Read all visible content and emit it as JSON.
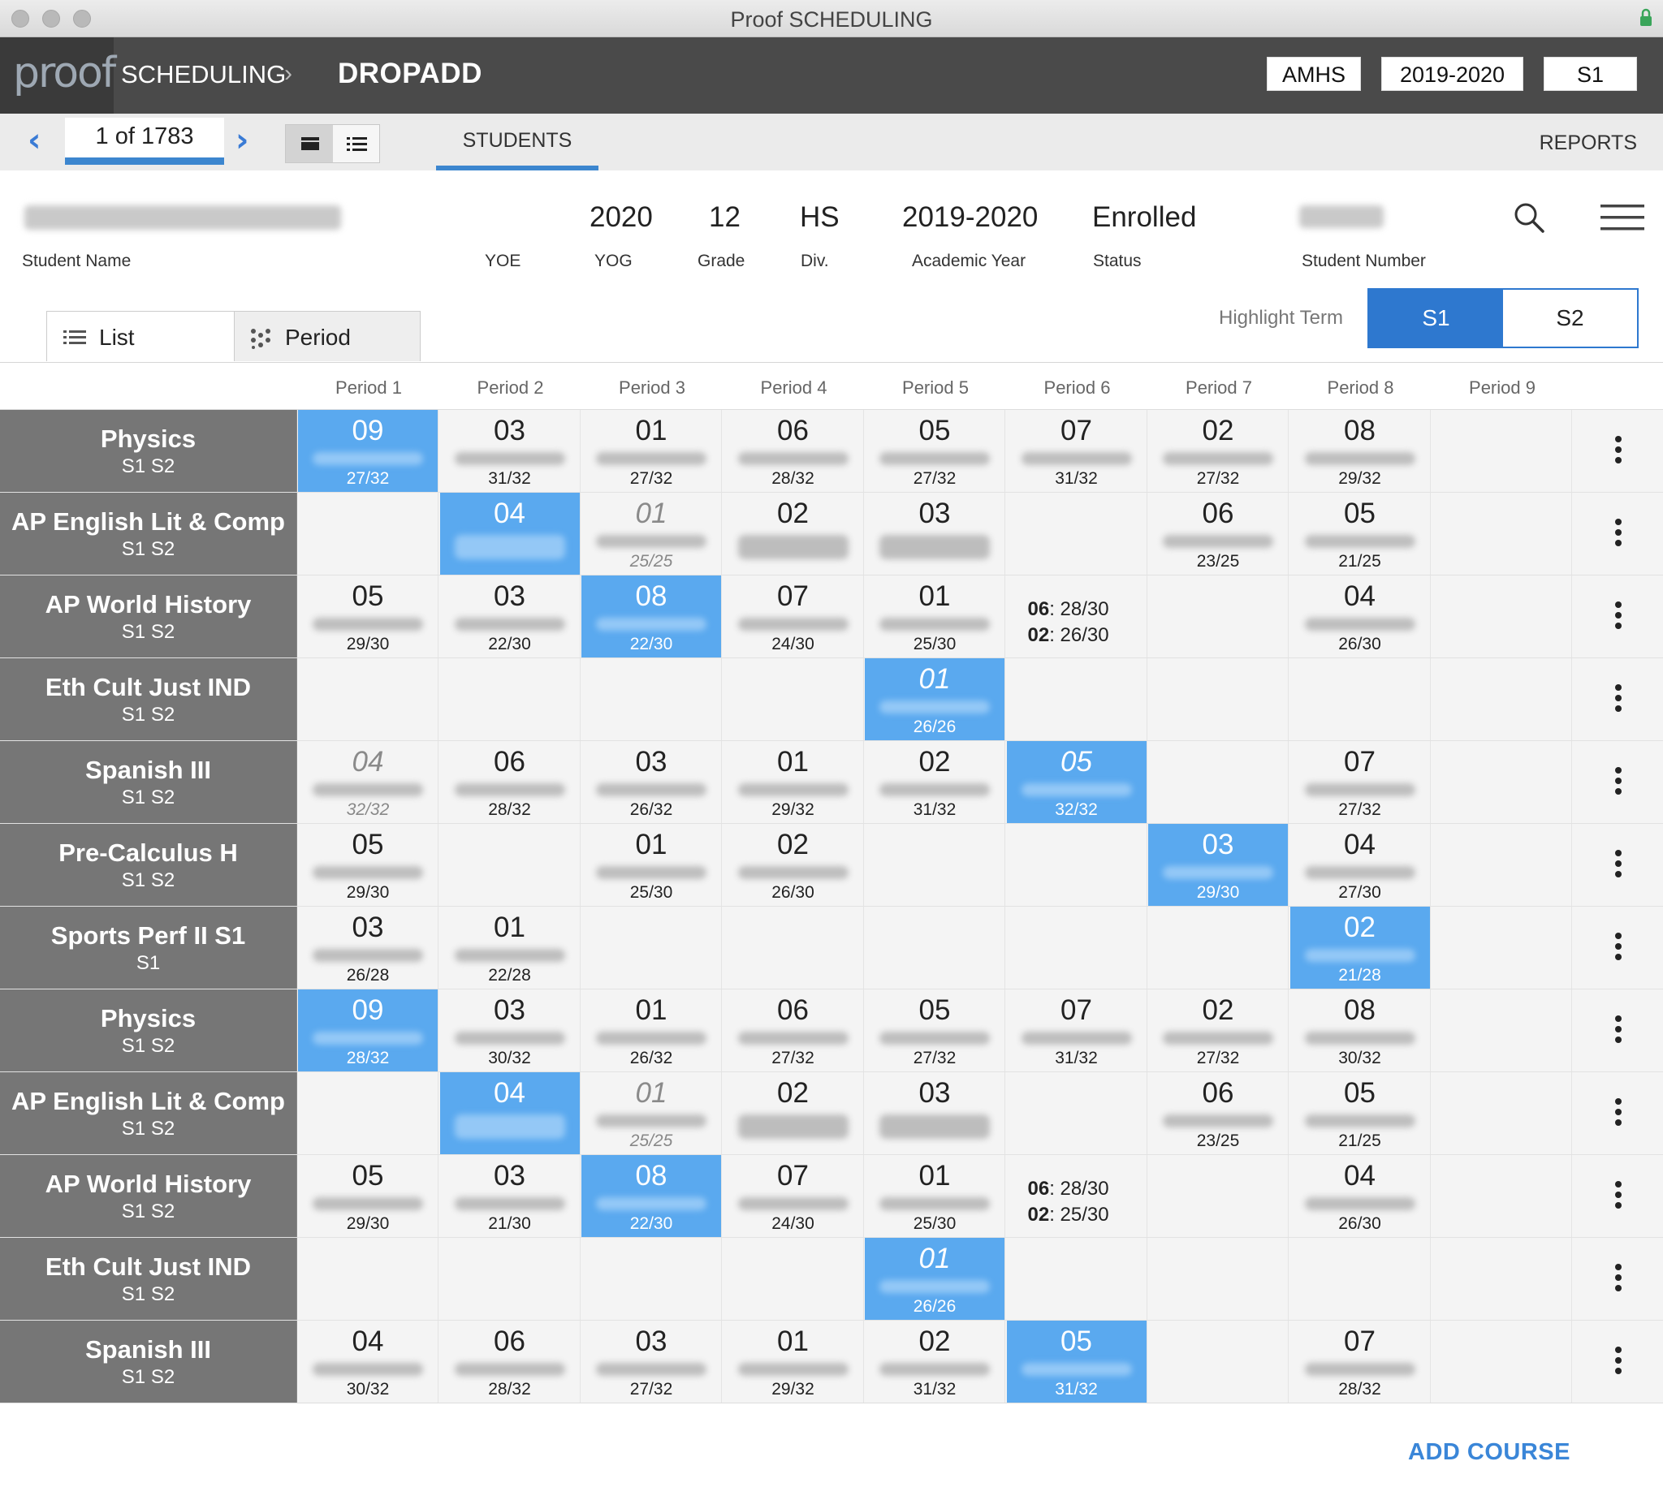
{
  "window": {
    "title": "Proof SCHEDULING"
  },
  "header": {
    "logo_text": "proof",
    "breadcrumb": "SCHEDULING",
    "module": "DROPADD",
    "school": "AMHS",
    "year": "2019-2020",
    "term": "S1"
  },
  "nav": {
    "record": "1 of 1783",
    "tab_students": "STUDENTS",
    "reports": "REPORTS"
  },
  "student": {
    "yog": "2020",
    "grade": "12",
    "division": "HS",
    "academic_year": "2019-2020",
    "status": "Enrolled",
    "labels": {
      "name": "Student Name",
      "yoe": "YOE",
      "yog": "YOG",
      "grade": "Grade",
      "div": "Div.",
      "academic_year": "Academic Year",
      "status": "Status",
      "student_number": "Student Number"
    }
  },
  "view_tabs": {
    "list": "List",
    "period": "Period"
  },
  "highlight": {
    "label": "Highlight Term",
    "s1": "S1",
    "s2": "S2",
    "active": "S1"
  },
  "periods": [
    "Period 1",
    "Period 2",
    "Period 3",
    "Period 4",
    "Period 5",
    "Period 6",
    "Period 7",
    "Period 8",
    "Period 9"
  ],
  "rows": [
    {
      "course": "Physics",
      "terms": "S1 S2",
      "cells": [
        {
          "p": 0,
          "sec": "09",
          "cnt": "27/32",
          "hl": true
        },
        {
          "p": 1,
          "sec": "03",
          "cnt": "31/32"
        },
        {
          "p": 2,
          "sec": "01",
          "cnt": "27/32"
        },
        {
          "p": 3,
          "sec": "06",
          "cnt": "28/32"
        },
        {
          "p": 4,
          "sec": "05",
          "cnt": "27/32"
        },
        {
          "p": 5,
          "sec": "07",
          "cnt": "31/32"
        },
        {
          "p": 6,
          "sec": "02",
          "cnt": "27/32"
        },
        {
          "p": 7,
          "sec": "08",
          "cnt": "29/32"
        }
      ]
    },
    {
      "course": "AP English Lit & Comp",
      "terms": "S1 S2",
      "cells": [
        {
          "p": 1,
          "sec": "04",
          "cnt": "",
          "hl": true
        },
        {
          "p": 2,
          "sec": "01",
          "cnt": "25/25",
          "alt": true
        },
        {
          "p": 3,
          "sec": "02",
          "cnt": ""
        },
        {
          "p": 4,
          "sec": "03",
          "cnt": ""
        },
        {
          "p": 6,
          "sec": "06",
          "cnt": "23/25"
        },
        {
          "p": 7,
          "sec": "05",
          "cnt": "21/25"
        }
      ]
    },
    {
      "course": "AP World History",
      "terms": "S1 S2",
      "cells": [
        {
          "p": 0,
          "sec": "05",
          "cnt": "29/30"
        },
        {
          "p": 1,
          "sec": "03",
          "cnt": "22/30"
        },
        {
          "p": 2,
          "sec": "08",
          "cnt": "22/30",
          "hl": true
        },
        {
          "p": 3,
          "sec": "07",
          "cnt": "24/30"
        },
        {
          "p": 4,
          "sec": "01",
          "cnt": "25/30"
        },
        {
          "p": 5,
          "multi": [
            {
              "s": "06",
              "c": ": 28/30"
            },
            {
              "s": "02",
              "c": ": 26/30"
            }
          ]
        },
        {
          "p": 7,
          "sec": "04",
          "cnt": "26/30"
        }
      ]
    },
    {
      "course": "Eth Cult Just IND",
      "terms": "S1 S2",
      "cells": [
        {
          "p": 4,
          "sec": "01",
          "cnt": "26/26",
          "hl": true,
          "alt": true
        }
      ]
    },
    {
      "course": "Spanish III",
      "terms": "S1 S2",
      "cells": [
        {
          "p": 0,
          "sec": "04",
          "cnt": "32/32",
          "alt": true
        },
        {
          "p": 1,
          "sec": "06",
          "cnt": "28/32"
        },
        {
          "p": 2,
          "sec": "03",
          "cnt": "26/32"
        },
        {
          "p": 3,
          "sec": "01",
          "cnt": "29/32"
        },
        {
          "p": 4,
          "sec": "02",
          "cnt": "31/32"
        },
        {
          "p": 5,
          "sec": "05",
          "cnt": "32/32",
          "hl": true,
          "alt": true
        },
        {
          "p": 7,
          "sec": "07",
          "cnt": "27/32"
        }
      ]
    },
    {
      "course": "Pre-Calculus H",
      "terms": "S1 S2",
      "cells": [
        {
          "p": 0,
          "sec": "05",
          "cnt": "29/30"
        },
        {
          "p": 2,
          "sec": "01",
          "cnt": "25/30"
        },
        {
          "p": 3,
          "sec": "02",
          "cnt": "26/30"
        },
        {
          "p": 6,
          "sec": "03",
          "cnt": "29/30",
          "hl": true
        },
        {
          "p": 7,
          "sec": "04",
          "cnt": "27/30"
        }
      ]
    },
    {
      "course": "Sports Perf II S1",
      "terms": "S1",
      "cells": [
        {
          "p": 0,
          "sec": "03",
          "cnt": "26/28"
        },
        {
          "p": 1,
          "sec": "01",
          "cnt": "22/28"
        },
        {
          "p": 7,
          "sec": "02",
          "cnt": "21/28",
          "hl": true
        }
      ]
    },
    {
      "course": "Physics",
      "terms": "S1 S2",
      "cells": [
        {
          "p": 0,
          "sec": "09",
          "cnt": "28/32",
          "hl": true
        },
        {
          "p": 1,
          "sec": "03",
          "cnt": "30/32"
        },
        {
          "p": 2,
          "sec": "01",
          "cnt": "26/32"
        },
        {
          "p": 3,
          "sec": "06",
          "cnt": "27/32"
        },
        {
          "p": 4,
          "sec": "05",
          "cnt": "27/32"
        },
        {
          "p": 5,
          "sec": "07",
          "cnt": "31/32"
        },
        {
          "p": 6,
          "sec": "02",
          "cnt": "27/32"
        },
        {
          "p": 7,
          "sec": "08",
          "cnt": "30/32"
        }
      ]
    },
    {
      "course": "AP English Lit & Comp",
      "terms": "S1 S2",
      "cells": [
        {
          "p": 1,
          "sec": "04",
          "cnt": "",
          "hl": true
        },
        {
          "p": 2,
          "sec": "01",
          "cnt": "25/25",
          "alt": true
        },
        {
          "p": 3,
          "sec": "02",
          "cnt": ""
        },
        {
          "p": 4,
          "sec": "03",
          "cnt": ""
        },
        {
          "p": 6,
          "sec": "06",
          "cnt": "23/25"
        },
        {
          "p": 7,
          "sec": "05",
          "cnt": "21/25"
        }
      ]
    },
    {
      "course": "AP World History",
      "terms": "S1 S2",
      "cells": [
        {
          "p": 0,
          "sec": "05",
          "cnt": "29/30"
        },
        {
          "p": 1,
          "sec": "03",
          "cnt": "21/30"
        },
        {
          "p": 2,
          "sec": "08",
          "cnt": "22/30",
          "hl": true
        },
        {
          "p": 3,
          "sec": "07",
          "cnt": "24/30"
        },
        {
          "p": 4,
          "sec": "01",
          "cnt": "25/30"
        },
        {
          "p": 5,
          "multi": [
            {
              "s": "06",
              "c": ": 28/30"
            },
            {
              "s": "02",
              "c": ": 25/30"
            }
          ]
        },
        {
          "p": 7,
          "sec": "04",
          "cnt": "26/30"
        }
      ]
    },
    {
      "course": "Eth Cult Just IND",
      "terms": "S1 S2",
      "cells": [
        {
          "p": 4,
          "sec": "01",
          "cnt": "26/26",
          "hl": true,
          "alt": true
        }
      ]
    },
    {
      "course": "Spanish III",
      "terms": "S1 S2",
      "cells": [
        {
          "p": 0,
          "sec": "04",
          "cnt": "30/32"
        },
        {
          "p": 1,
          "sec": "06",
          "cnt": "28/32"
        },
        {
          "p": 2,
          "sec": "03",
          "cnt": "27/32"
        },
        {
          "p": 3,
          "sec": "01",
          "cnt": "29/32"
        },
        {
          "p": 4,
          "sec": "02",
          "cnt": "31/32"
        },
        {
          "p": 5,
          "sec": "05",
          "cnt": "31/32",
          "hl": true
        },
        {
          "p": 7,
          "sec": "07",
          "cnt": "28/32"
        }
      ]
    }
  ],
  "footer": {
    "add_course": "ADD COURSE"
  },
  "colors": {
    "accent": "#2e78cf",
    "highlight_cell": "#5aa9ef",
    "course_bg": "#767676",
    "header_bg": "#4a4a4a"
  },
  "icons": [
    "lock-icon",
    "chevron-left-icon",
    "chevron-right-icon",
    "grid-view-icon",
    "list-view-icon",
    "search-icon",
    "hamburger-menu-icon",
    "list-icon",
    "period-icon",
    "kebab-menu-icon"
  ]
}
